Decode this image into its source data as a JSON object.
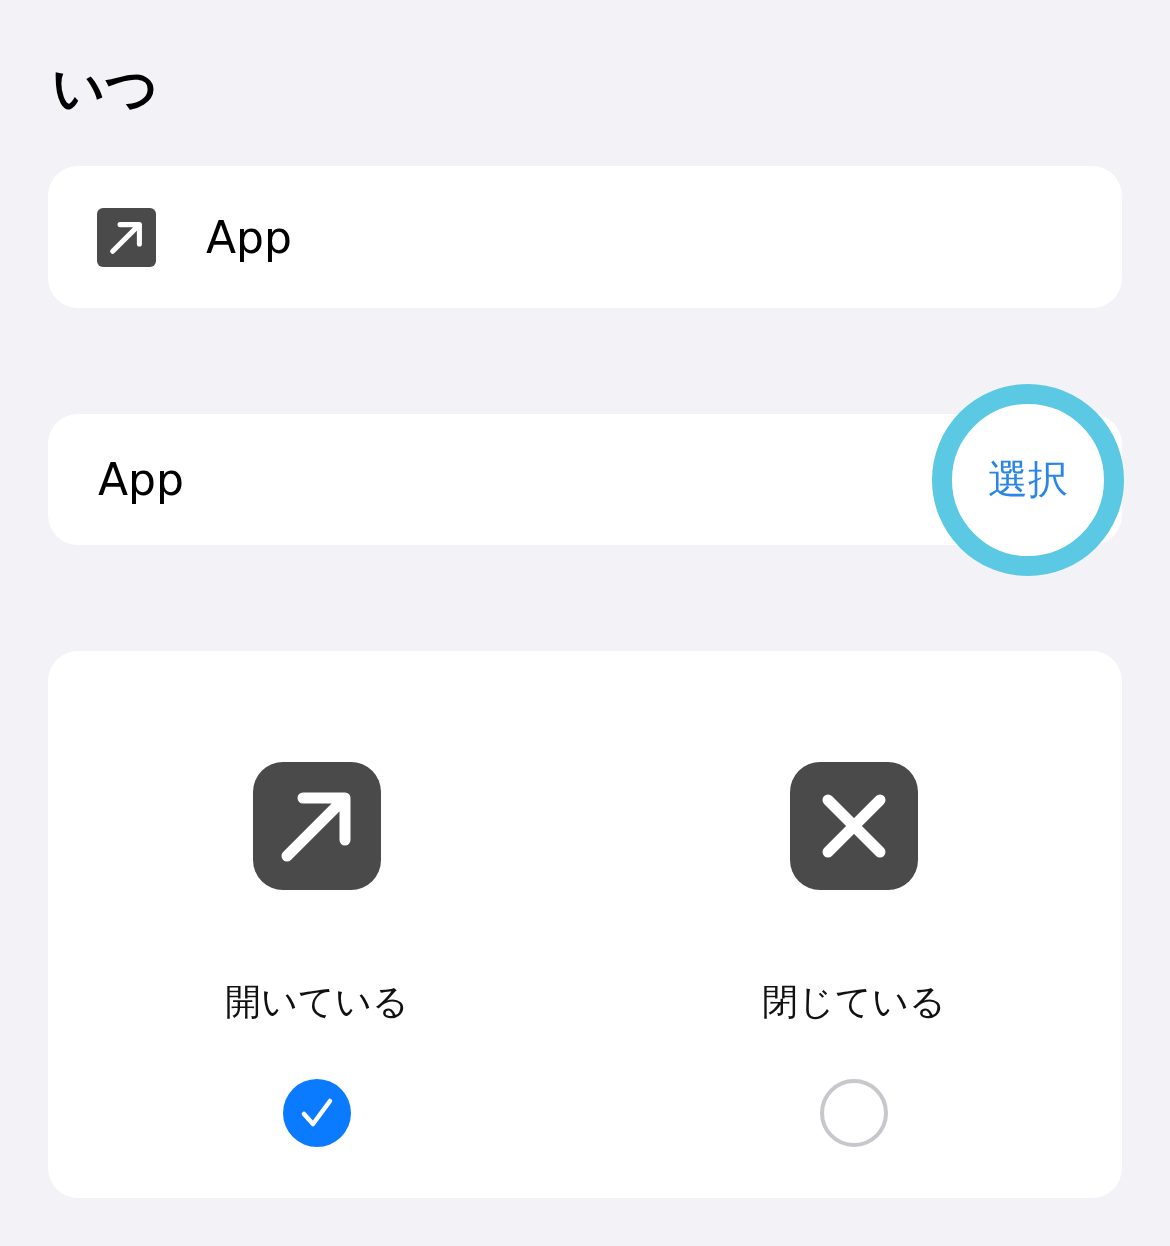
{
  "heading": "いつ",
  "trigger": {
    "label": "App"
  },
  "app_row": {
    "label": "App",
    "action": "選択",
    "highlighted": true
  },
  "options": [
    {
      "label": "開いている",
      "kind": "open",
      "selected": true
    },
    {
      "label": "閉じている",
      "kind": "closed",
      "selected": false
    }
  ]
}
